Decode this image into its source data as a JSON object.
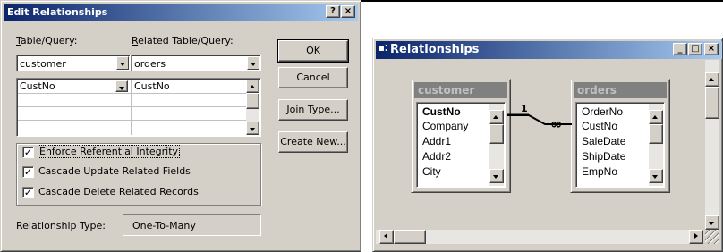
{
  "edit_dialog": {
    "title": "Edit Relationships",
    "title_buttons": {
      "help": "?",
      "close": "×"
    },
    "table_query_label": "Table/Query:",
    "table_query_accel": "T",
    "related_label": "Related Table/Query:",
    "related_accel": "R",
    "table_value": "customer",
    "related_value": "orders",
    "grid_rows": [
      {
        "left": "CustNo",
        "right": "CustNo"
      },
      {
        "left": "",
        "right": ""
      },
      {
        "left": "",
        "right": ""
      },
      {
        "left": "",
        "right": ""
      }
    ],
    "buttons": {
      "ok": "OK",
      "cancel": "Cancel",
      "join_type": "Join Type...",
      "create_new": "Create New..."
    },
    "checkboxes": [
      {
        "label": "Enforce Referential Integrity",
        "checked": true
      },
      {
        "label": "Cascade Update Related Fields",
        "checked": true
      },
      {
        "label": "Cascade Delete Related Records",
        "checked": true
      }
    ],
    "relationship_type_label": "Relationship Type:",
    "relationship_type_value": "One-To-Many"
  },
  "relationships_window": {
    "title": "Relationships",
    "title_buttons": {
      "minimize": "_",
      "maximize": "□",
      "close": "×"
    },
    "customer_table": {
      "title": "customer",
      "fields": [
        "CustNo",
        "Company",
        "Addr1",
        "Addr2",
        "City"
      ]
    },
    "orders_table": {
      "title": "orders",
      "fields": [
        "OrderNo",
        "CustNo",
        "SaleDate",
        "ShipDate",
        "EmpNo"
      ]
    },
    "join": {
      "one_label": "1",
      "many_label": "∞"
    }
  }
}
